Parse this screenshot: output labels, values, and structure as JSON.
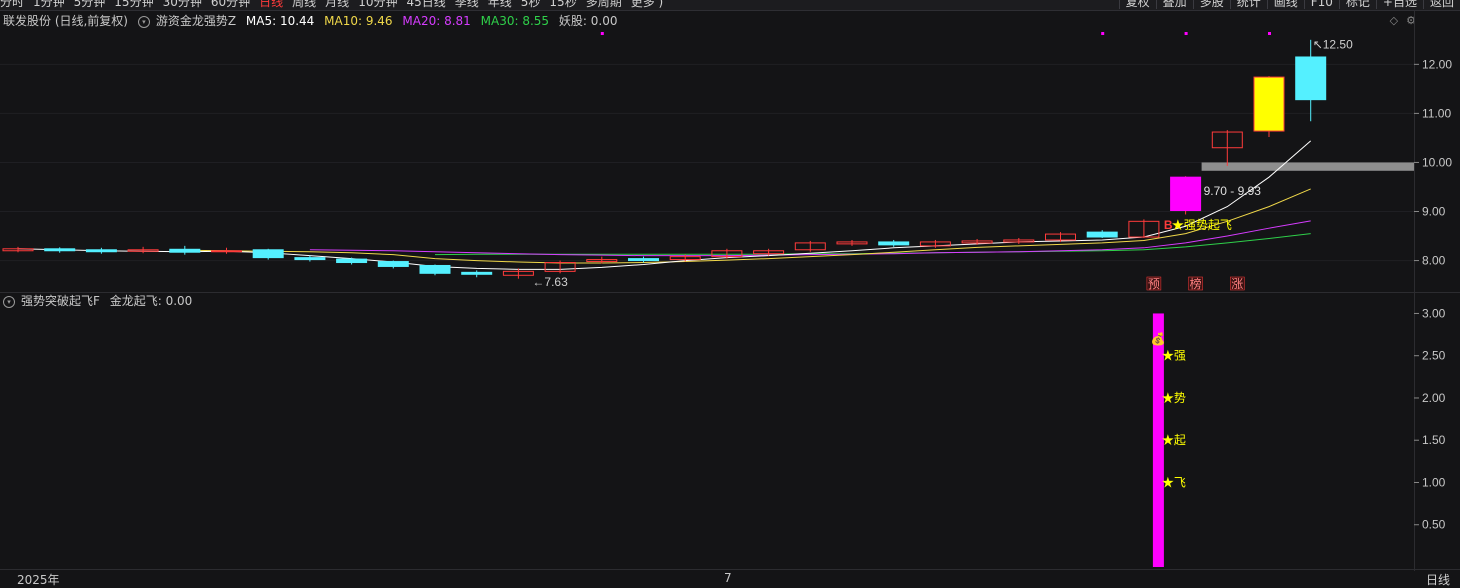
{
  "toolbar": {
    "periods": [
      "分时",
      "1分钟",
      "5分钟",
      "15分钟",
      "30分钟",
      "60分钟",
      "日线",
      "周线",
      "月线",
      "10分钟",
      "45日线",
      "季线",
      "年线",
      "5秒",
      "15秒",
      "多周期",
      "更多 )"
    ],
    "active_period": "日线",
    "tools": [
      "复权",
      "叠加",
      "多股",
      "统计",
      "画线",
      "F10",
      "标记",
      "+自选",
      "返回"
    ]
  },
  "main_header": {
    "stock": "联发股份 (日线,前复权)",
    "indicator": "游资金龙强势Z",
    "ma5": "MA5: 10.44",
    "ma10": "MA10: 9.46",
    "ma20": "MA20: 8.81",
    "ma30": "MA30: 8.55",
    "yao": "妖股: 0.00"
  },
  "sub_header": {
    "indicator": "强势突破起飞F",
    "value": "金龙起飞: 0.00"
  },
  "colors": {
    "up": "#ff3b3b",
    "down": "#54f0ff",
    "ma5": "#ffffff",
    "ma10": "#f0d84a",
    "ma20": "#d63cff",
    "ma30": "#2fd04a",
    "signal": "#ff00ff",
    "yellow": "#ffff00"
  },
  "chart_data": [
    {
      "type": "candlestick",
      "y_axis_labels": [
        "12.00",
        "11.00",
        "10.00",
        "9.00",
        "8.00"
      ],
      "ylim": [
        7.4,
        12.7
      ],
      "candles": [
        {
          "o": 8.2,
          "c": 8.24,
          "h": 8.28,
          "l": 8.17
        },
        {
          "o": 8.24,
          "c": 8.2,
          "h": 8.27,
          "l": 8.16
        },
        {
          "o": 8.22,
          "c": 8.18,
          "h": 8.26,
          "l": 8.14
        },
        {
          "o": 8.19,
          "c": 8.22,
          "h": 8.28,
          "l": 8.15
        },
        {
          "o": 8.23,
          "c": 8.17,
          "h": 8.3,
          "l": 8.12
        },
        {
          "o": 8.18,
          "c": 8.2,
          "h": 8.26,
          "l": 8.14
        },
        {
          "o": 8.22,
          "c": 8.06,
          "h": 8.24,
          "l": 8.02
        },
        {
          "o": 8.06,
          "c": 8.02,
          "h": 8.1,
          "l": 7.98
        },
        {
          "o": 8.03,
          "c": 7.96,
          "h": 8.06,
          "l": 7.92
        },
        {
          "o": 7.98,
          "c": 7.88,
          "h": 8.0,
          "l": 7.84
        },
        {
          "o": 7.9,
          "c": 7.74,
          "h": 7.92,
          "l": 7.7
        },
        {
          "o": 7.76,
          "c": 7.72,
          "h": 7.8,
          "l": 7.66
        },
        {
          "o": 7.7,
          "c": 7.78,
          "h": 7.84,
          "l": 7.63
        },
        {
          "o": 7.78,
          "c": 7.96,
          "h": 8.0,
          "l": 7.74
        },
        {
          "o": 7.98,
          "c": 8.02,
          "h": 8.08,
          "l": 7.94
        },
        {
          "o": 8.04,
          "c": 8.0,
          "h": 8.08,
          "l": 7.96
        },
        {
          "o": 8.02,
          "c": 8.08,
          "h": 8.12,
          "l": 7.98
        },
        {
          "o": 8.08,
          "c": 8.2,
          "h": 8.24,
          "l": 8.04
        },
        {
          "o": 8.14,
          "c": 8.2,
          "h": 8.24,
          "l": 8.1
        },
        {
          "o": 8.22,
          "c": 8.36,
          "h": 8.4,
          "l": 8.18
        },
        {
          "o": 8.34,
          "c": 8.38,
          "h": 8.42,
          "l": 8.3
        },
        {
          "o": 8.38,
          "c": 8.32,
          "h": 8.42,
          "l": 8.28
        },
        {
          "o": 8.3,
          "c": 8.38,
          "h": 8.42,
          "l": 8.26
        },
        {
          "o": 8.36,
          "c": 8.4,
          "h": 8.44,
          "l": 8.32
        },
        {
          "o": 8.38,
          "c": 8.42,
          "h": 8.46,
          "l": 8.34
        },
        {
          "o": 8.42,
          "c": 8.54,
          "h": 8.58,
          "l": 8.38
        },
        {
          "o": 8.58,
          "c": 8.48,
          "h": 8.62,
          "l": 8.46
        },
        {
          "o": 8.48,
          "c": 8.8,
          "h": 8.84,
          "l": 8.46
        },
        {
          "o": 9.02,
          "c": 9.7,
          "h": 9.72,
          "l": 8.94
        },
        {
          "o": 10.3,
          "c": 10.62,
          "h": 10.66,
          "l": 9.93
        },
        {
          "o": 10.64,
          "c": 11.74,
          "h": 11.76,
          "l": 10.52
        },
        {
          "o": 12.15,
          "c": 11.28,
          "h": 12.5,
          "l": 10.84
        }
      ],
      "highlight_indices": [
        28,
        30
      ],
      "marker_low": "←7.63",
      "marker_high": "12.50",
      "zone_label": "9.70 - 9.93",
      "signal_text": "★强势起飞",
      "signal_b": "B",
      "tags": [
        "预",
        "榜",
        "涨"
      ],
      "ma5": [
        8.24,
        8.22,
        8.2,
        8.19,
        8.18,
        8.19,
        8.16,
        8.1,
        8.04,
        7.97,
        7.88,
        7.84,
        7.82,
        7.82,
        7.86,
        7.92,
        8.0,
        8.06,
        8.1,
        8.15,
        8.2,
        8.26,
        8.3,
        8.34,
        8.38,
        8.4,
        8.42,
        8.48,
        8.7,
        9.1,
        9.7,
        10.44
      ],
      "ma10": [
        null,
        null,
        null,
        null,
        8.21,
        8.2,
        8.19,
        8.18,
        8.16,
        8.12,
        8.04,
        8.0,
        7.97,
        7.95,
        7.95,
        7.96,
        7.98,
        8.01,
        8.04,
        8.08,
        8.12,
        8.17,
        8.22,
        8.27,
        8.3,
        8.33,
        8.36,
        8.41,
        8.55,
        8.8,
        9.1,
        9.46
      ],
      "ma20": [
        null,
        null,
        null,
        null,
        null,
        null,
        null,
        8.22,
        8.21,
        8.2,
        8.18,
        8.16,
        8.14,
        8.12,
        8.11,
        8.1,
        8.1,
        8.1,
        8.11,
        8.12,
        8.13,
        8.14,
        8.16,
        8.17,
        8.18,
        8.2,
        8.22,
        8.26,
        8.36,
        8.5,
        8.66,
        8.81
      ],
      "ma30": [
        null,
        null,
        null,
        null,
        null,
        null,
        null,
        null,
        null,
        null,
        8.12,
        8.13,
        8.13,
        8.13,
        8.13,
        8.13,
        8.13,
        8.13,
        8.13,
        8.14,
        8.14,
        8.15,
        8.16,
        8.17,
        8.18,
        8.19,
        8.2,
        8.22,
        8.28,
        8.36,
        8.45,
        8.55
      ]
    },
    {
      "type": "bar",
      "y_axis_labels": [
        "3.00",
        "2.50",
        "2.00",
        "1.50",
        "1.00",
        "0.50"
      ],
      "ylim": [
        0,
        3.1
      ],
      "bar_index": 27,
      "bar_value": 3.0,
      "stars": [
        "★强",
        "★势",
        "★起",
        "★飞"
      ],
      "star_values": [
        2.5,
        2.0,
        1.5,
        1.0
      ],
      "bag_icon_value": 2.7
    }
  ],
  "time_axis": {
    "year_label": "2025年",
    "month_label": "7"
  },
  "period_label": "日线"
}
